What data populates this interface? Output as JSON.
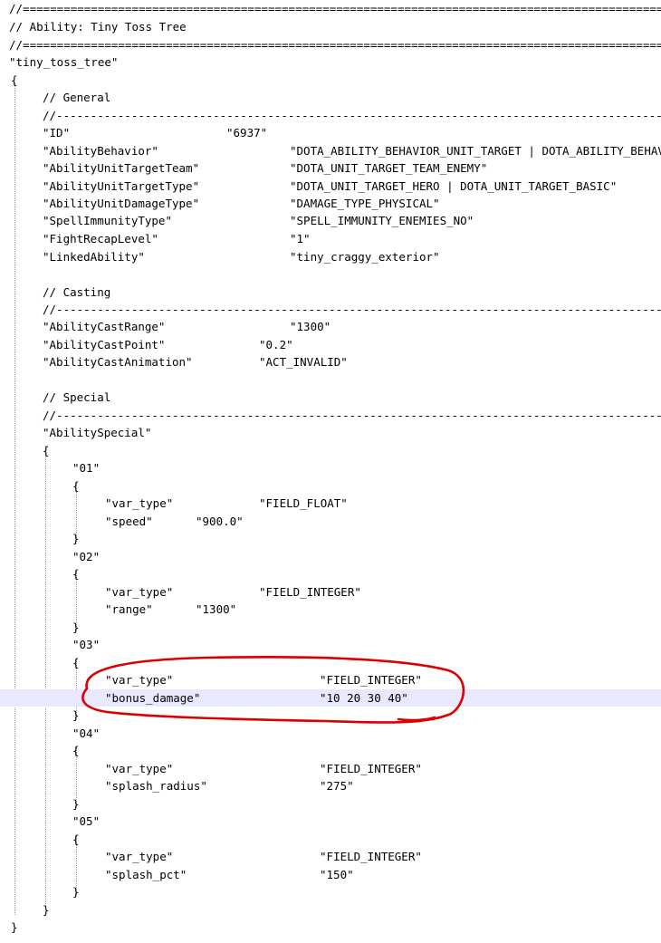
{
  "editor": {
    "lines": [
      {
        "t": "//=========================================================================================================="
      },
      {
        "t": "// Ability: Tiny Toss Tree"
      },
      {
        "t": "//=========================================================================================================="
      },
      {
        "t": "\"tiny_toss_tree\""
      },
      {
        "t": "{"
      },
      {
        "t": "// General"
      },
      {
        "t": "//-----------------------------------------------------------------------------------------------------------"
      },
      {
        "k": "\"ID\"",
        "v": "\"6937\""
      },
      {
        "k": "\"AbilityBehavior\"",
        "v": "\"DOTA_ABILITY_BEHAVIOR_UNIT_TARGET | DOTA_ABILITY_BEHAVIOR_IGNORE_BACKSWING\""
      },
      {
        "k": "\"AbilityUnitTargetTeam\"",
        "v": "\"DOTA_UNIT_TARGET_TEAM_ENEMY\""
      },
      {
        "k": "\"AbilityUnitTargetType\"",
        "v": "\"DOTA_UNIT_TARGET_HERO | DOTA_UNIT_TARGET_BASIC\""
      },
      {
        "k": "\"AbilityUnitDamageType\"",
        "v": "\"DAMAGE_TYPE_PHYSICAL\""
      },
      {
        "k": "\"SpellImmunityType\"",
        "v": "\"SPELL_IMMUNITY_ENEMIES_NO\""
      },
      {
        "k": "\"FightRecapLevel\"",
        "v": "\"1\""
      },
      {
        "k": "\"LinkedAbility\"",
        "v": "\"tiny_craggy_exterior\""
      },
      {
        "t": ""
      },
      {
        "t": "// Casting"
      },
      {
        "t": "//-----------------------------------------------------------------------------------------------------------"
      },
      {
        "k": "\"AbilityCastRange\"",
        "v": "\"1300\""
      },
      {
        "k": "\"AbilityCastPoint\"",
        "v": "\"0.2\""
      },
      {
        "k": "\"AbilityCastAnimation\"",
        "v": "\"ACT_INVALID\""
      },
      {
        "t": ""
      },
      {
        "t": "// Special"
      },
      {
        "t": "//-----------------------------------------------------------------------------------------------------------"
      },
      {
        "t": "\"AbilitySpecial\""
      },
      {
        "t": "{"
      },
      {
        "t": "\"01\""
      },
      {
        "t": "{"
      },
      {
        "k": "\"var_type\"",
        "v": "\"FIELD_FLOAT\""
      },
      {
        "k": "\"speed\"",
        "v": "\"900.0\""
      },
      {
        "t": "}"
      },
      {
        "t": "\"02\""
      },
      {
        "t": "{"
      },
      {
        "k": "\"var_type\"",
        "v": "\"FIELD_INTEGER\""
      },
      {
        "k": "\"range\"",
        "v": "\"1300\""
      },
      {
        "t": "}"
      },
      {
        "t": "\"03\""
      },
      {
        "t": "{"
      },
      {
        "k": "\"var_type\"",
        "v": "\"FIELD_INTEGER\""
      },
      {
        "k": "\"bonus_damage\"",
        "v": "\"10 20 30 40\""
      },
      {
        "t": "}"
      },
      {
        "t": "\"04\""
      },
      {
        "t": "{"
      },
      {
        "k": "\"var_type\"",
        "v": "\"FIELD_INTEGER\""
      },
      {
        "k": "\"splash_radius\"",
        "v": "\"275\""
      },
      {
        "t": "}"
      },
      {
        "t": "\"05\""
      },
      {
        "t": "{"
      },
      {
        "k": "\"var_type\"",
        "v": "\"FIELD_INTEGER\""
      },
      {
        "k": "\"splash_pct\"",
        "v": "\"150\""
      },
      {
        "t": "}"
      },
      {
        "t": "}"
      },
      {
        "t": "}"
      }
    ]
  },
  "colors": {
    "text": "#000000",
    "current_line_highlight": "#e8e8ff",
    "indent_guide": "#9a9a9a",
    "annotation_circle": "#dd0000"
  },
  "annotation": {
    "shape": "hand-drawn ellipse",
    "target": "bonus_damage"
  }
}
